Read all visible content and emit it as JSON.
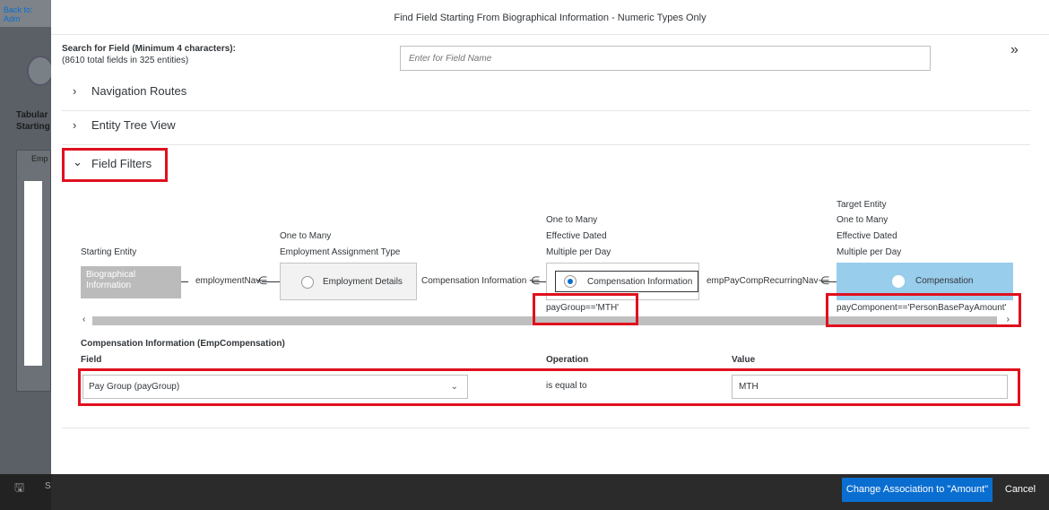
{
  "background": {
    "back_prefix": "Back to:",
    "back_link": "Adm",
    "side_label_1": "Tabular",
    "side_label_2": "Starting",
    "side_panel_label": "Emp",
    "footer_save": "S"
  },
  "dialog": {
    "title": "Find Field Starting From Biographical Information - Numeric Types Only",
    "search_label": "Search for Field (Minimum 4 characters):",
    "search_count": "(8610 total fields in 325 entities)",
    "search_placeholder": "Enter for Field Name",
    "expand_icon": "»",
    "sections": {
      "navigation_routes": "Navigation Routes",
      "entity_tree_view": "Entity Tree View",
      "field_filters": "Field Filters"
    }
  },
  "diagram": {
    "starting_entity_caption": "Starting Entity",
    "starting_entity_name": "Biographical Information",
    "link_1": "employmentNav",
    "node_2_caption_1": "One to Many",
    "node_2_caption_2": "Employment Assignment Type",
    "node_2_name": "Employment Details",
    "link_2": "Compensation Information",
    "node_3_caption_1": "One to Many",
    "node_3_caption_2": "Effective Dated",
    "node_3_caption_3": "Multiple per Day",
    "node_3_name": "Compensation Information",
    "node_3_filter": "payGroup=='MTH'",
    "link_3": "empPayCompRecurringNav",
    "node_4_caption_0": "Target Entity",
    "node_4_caption_1": "One to Many",
    "node_4_caption_2": "Effective Dated",
    "node_4_caption_3": "Multiple per Day",
    "node_4_name": "Compensation",
    "node_4_filter": "payComponent=='PersonBasePayAmount'"
  },
  "filter": {
    "title": "Compensation Information (EmpCompensation)",
    "col_field": "Field",
    "col_operation": "Operation",
    "col_value": "Value",
    "field_value": "Pay Group (payGroup)",
    "operation_value": "is equal to",
    "value_value": "MTH"
  },
  "footer": {
    "primary_button": "Change Association to \"Amount\"",
    "cancel_button": "Cancel"
  },
  "colors": {
    "accent": "#0a6ed1",
    "highlight_red": "#e0101e",
    "target_entity": "#99cdec"
  }
}
